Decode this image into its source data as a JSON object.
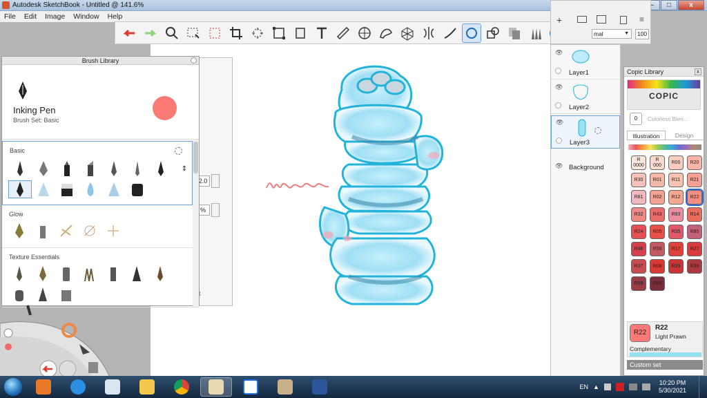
{
  "window": {
    "title": "Autodesk SketchBook - Untitled @ 141.6%",
    "minimize": "–",
    "maximize": "□",
    "close": "x"
  },
  "menu": [
    "File",
    "Edit",
    "Image",
    "Window",
    "Help"
  ],
  "toolbar_icons": [
    "undo-icon",
    "redo-icon",
    "zoom-icon",
    "select-icon",
    "crop-select-icon",
    "crop-icon",
    "transform-icon",
    "distort-icon",
    "fill-icon",
    "text-icon",
    "ruler-icon",
    "ellipse-guide-icon",
    "french-curve-icon",
    "perspective-icon",
    "symmetry-icon",
    "stroke-icon",
    "predictive-stroke-icon",
    "shape-icon",
    "copy-icon",
    "brush-library-icon",
    "color-wheel-icon",
    "copic-icon"
  ],
  "brush_library": {
    "title": "Brush Library",
    "current_name": "Inking Pen",
    "current_set": "Brush Set: Basic",
    "sections": [
      {
        "label": "Basic"
      },
      {
        "label": "Glow"
      },
      {
        "label": "Texture Essentials"
      }
    ]
  },
  "brush_props": {
    "size": "2.0",
    "opacity": "%",
    "footer": "t"
  },
  "layers": {
    "blend": "mal",
    "opacity": "100",
    "items": [
      {
        "name": "Layer1"
      },
      {
        "name": "Layer2"
      },
      {
        "name": "Layer3"
      },
      {
        "name": "Background"
      }
    ]
  },
  "copic": {
    "title": "Copic Library",
    "logo": "COPIC",
    "colorless_code": "0",
    "colorless_label": "Colorless Blen...",
    "tabs": [
      "Illustration",
      "Design"
    ],
    "swatches": [
      {
        "code": "R\n0000",
        "color": "#fde7dc"
      },
      {
        "code": "R\n000",
        "color": "#fbd9cc"
      },
      {
        "code": "R00",
        "color": "#f9cdbd"
      },
      {
        "code": "R20",
        "color": "#f8b4a6"
      },
      {
        "code": "R30",
        "color": "#f6c2b8"
      },
      {
        "code": "R01",
        "color": "#f6b8a8"
      },
      {
        "code": "R11",
        "color": "#f7c2b0"
      },
      {
        "code": "R21",
        "color": "#f5a093"
      },
      {
        "code": "R81",
        "color": "#f1b8c0"
      },
      {
        "code": "R02",
        "color": "#f4a292"
      },
      {
        "code": "R12",
        "color": "#f5a78f"
      },
      {
        "code": "R22",
        "color": "#f28e82"
      },
      {
        "code": "R32",
        "color": "#ee8a86"
      },
      {
        "code": "R43",
        "color": "#ea6a6a"
      },
      {
        "code": "R83",
        "color": "#ec8ea0"
      },
      {
        "code": "R14",
        "color": "#ea6a5c"
      },
      {
        "code": "R24",
        "color": "#e65054"
      },
      {
        "code": "R05",
        "color": "#e8504a"
      },
      {
        "code": "R35",
        "color": "#e0586a"
      },
      {
        "code": "R85",
        "color": "#c3607a"
      },
      {
        "code": "R46",
        "color": "#d4404c"
      },
      {
        "code": "R56",
        "color": "#c35a62"
      },
      {
        "code": "R17",
        "color": "#e0423a"
      },
      {
        "code": "R27",
        "color": "#d93c3c"
      },
      {
        "code": "R37",
        "color": "#c94c50"
      },
      {
        "code": "R08",
        "color": "#d83a34"
      },
      {
        "code": "R29",
        "color": "#c9363a"
      },
      {
        "code": "R39",
        "color": "#a83a40"
      },
      {
        "code": "R59",
        "color": "#9a3c44"
      },
      {
        "code": "R89",
        "color": "#7a2c38"
      }
    ],
    "selected_index": 11,
    "current": {
      "code": "R22",
      "name": "Light Prawn",
      "complementary": "Complementary"
    },
    "custom_set": "Custom set"
  },
  "taskbar": {
    "lang": "EN",
    "time": "10:20 PM",
    "date": "5/30/2021"
  }
}
